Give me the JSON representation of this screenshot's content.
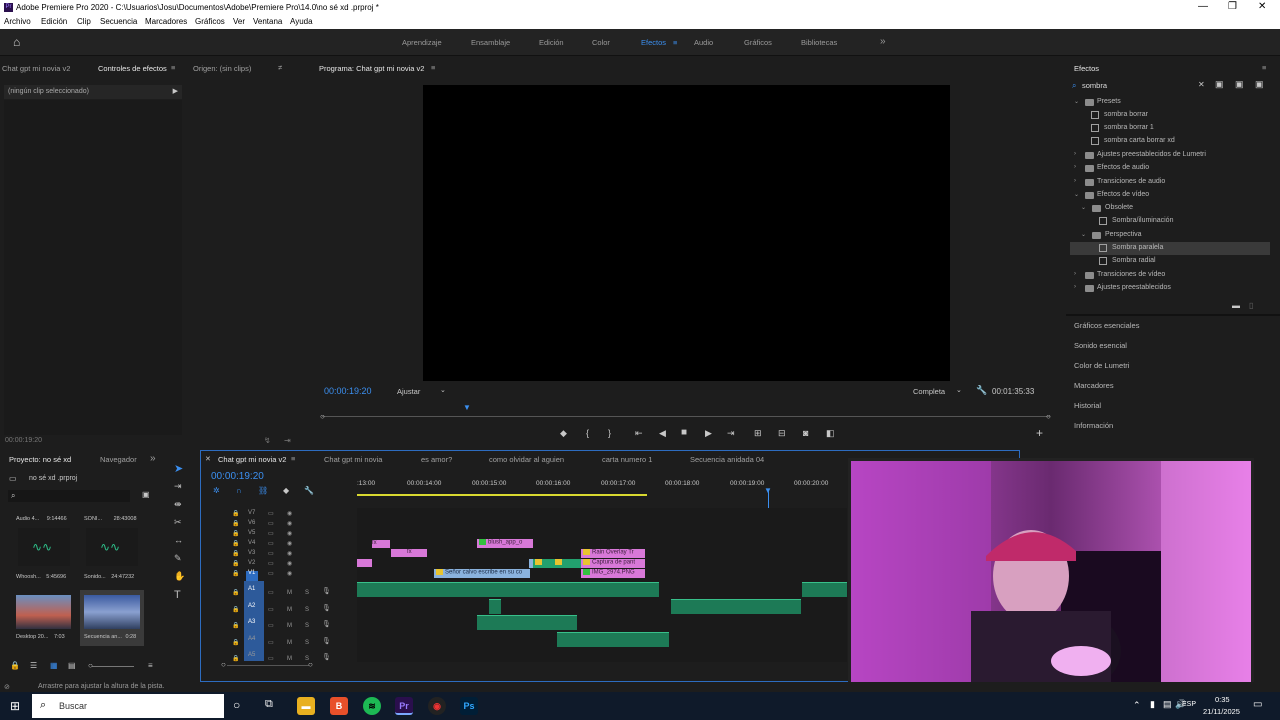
{
  "window": {
    "title": "Adobe Premiere Pro 2020 - C:\\Usuarios\\Josu\\Documentos\\Adobe\\Premiere Pro\\14.0\\no sé xd .prproj *"
  },
  "menu": [
    "Archivo",
    "Edición",
    "Clip",
    "Secuencia",
    "Marcadores",
    "Gráficos",
    "Ver",
    "Ventana",
    "Ayuda"
  ],
  "workspaces": [
    "Aprendizaje",
    "Ensamblaje",
    "Edición",
    "Color",
    "Efectos",
    "Audio",
    "Gráficos",
    "Bibliotecas"
  ],
  "active_workspace": "Efectos",
  "left_panel": {
    "tabs": [
      "Chat gpt mi novia v2",
      "Controles de efectos",
      "Origen: (sin clips)"
    ],
    "no_clip": "(ningún clip seleccionado)",
    "timecode": "00:00:19:20"
  },
  "program": {
    "tab": "Programa: Chat gpt mi novia v2",
    "timecode": "00:00:19:20",
    "fit": "Ajustar",
    "quality": "Completa",
    "duration": "00:01:35:33"
  },
  "effects": {
    "title": "Efectos",
    "search_value": "sombra",
    "tree": [
      {
        "label": "Presets",
        "level": 0,
        "type": "folder",
        "open": true
      },
      {
        "label": "sombra borrar",
        "level": 1,
        "type": "fx"
      },
      {
        "label": "sombra borrar 1",
        "level": 1,
        "type": "fx"
      },
      {
        "label": "sombra carta borrar xd",
        "level": 1,
        "type": "fx"
      },
      {
        "label": "Ajustes preestablecidos de Lumetri",
        "level": 0,
        "type": "folder",
        "open": false
      },
      {
        "label": "Efectos de audio",
        "level": 0,
        "type": "folder",
        "open": false
      },
      {
        "label": "Transiciones de audio",
        "level": 0,
        "type": "folder",
        "open": false
      },
      {
        "label": "Efectos de vídeo",
        "level": 0,
        "type": "folder",
        "open": true
      },
      {
        "label": "Obsolete",
        "level": 1,
        "type": "folder",
        "open": true
      },
      {
        "label": "Sombra/iluminación",
        "level": 2,
        "type": "fx"
      },
      {
        "label": "Perspectiva",
        "level": 1,
        "type": "folder",
        "open": true
      },
      {
        "label": "Sombra paralela",
        "level": 2,
        "type": "fx",
        "selected": true
      },
      {
        "label": "Sombra radial",
        "level": 2,
        "type": "fx"
      },
      {
        "label": "Transiciones de vídeo",
        "level": 0,
        "type": "folder",
        "open": false
      },
      {
        "label": "Ajustes preestablecidos",
        "level": 0,
        "type": "folder",
        "open": false
      }
    ],
    "sections": [
      "Gráficos esenciales",
      "Sonido esencial",
      "Color de Lumetri",
      "Marcadores",
      "Historial",
      "Información"
    ]
  },
  "project": {
    "tabs": [
      "Proyecto: no sé xd",
      "Navegador"
    ],
    "file": "no sé xd .prproj",
    "items": [
      {
        "name": "Audio 4...",
        "dur": "9:14466"
      },
      {
        "name": "SONI...",
        "dur": "28:43008"
      },
      {
        "name": "Whoosh...",
        "dur": "5:45696"
      },
      {
        "name": "Sonido...",
        "dur": "24:47232"
      },
      {
        "name": "Desktop 20...",
        "dur": "7:03"
      },
      {
        "name": "Secuencia an...",
        "dur": "0:28"
      }
    ]
  },
  "timeline": {
    "tabs": [
      "Chat gpt mi novia v2",
      "Chat gpt mi novia",
      "es amor?",
      "como olvidar al aguien",
      "carta numero 1",
      "Secuencia anidada 04"
    ],
    "timecode": "00:00:19:20",
    "ruler": [
      ":13:00",
      "00:00:14:00",
      "00:00:15:00",
      "00:00:16:00",
      "00:00:17:00",
      "00:00:18:00",
      "00:00:19:00",
      "00:00:20:00"
    ],
    "video_tracks": [
      "V7",
      "V6",
      "V5",
      "V4",
      "V3",
      "V2",
      "V1"
    ],
    "audio_tracks": [
      "A1",
      "A2",
      "A3",
      "A4",
      "A5"
    ],
    "clips": {
      "blush": "blush_app_o",
      "rain": "Rain Overlay Tr",
      "captura": "Captura de pant",
      "img": "IMG_2974.PNG",
      "senor": "Señor calvo escribe en su co",
      "fx": "fx"
    },
    "track_labels": {
      "m": "M",
      "s": "S"
    }
  },
  "status": "Arrastre para ajustar la altura de la pista.",
  "taskbar": {
    "search": "Buscar",
    "lang": "ESP",
    "time": "0:35",
    "date": "21/11/2025"
  },
  "colors": {
    "accent": "#3b8ff0",
    "timeline_border": "#2d6cc0",
    "audio_clip": "#1d7a56",
    "video_clip_pink": "#d878d8"
  }
}
